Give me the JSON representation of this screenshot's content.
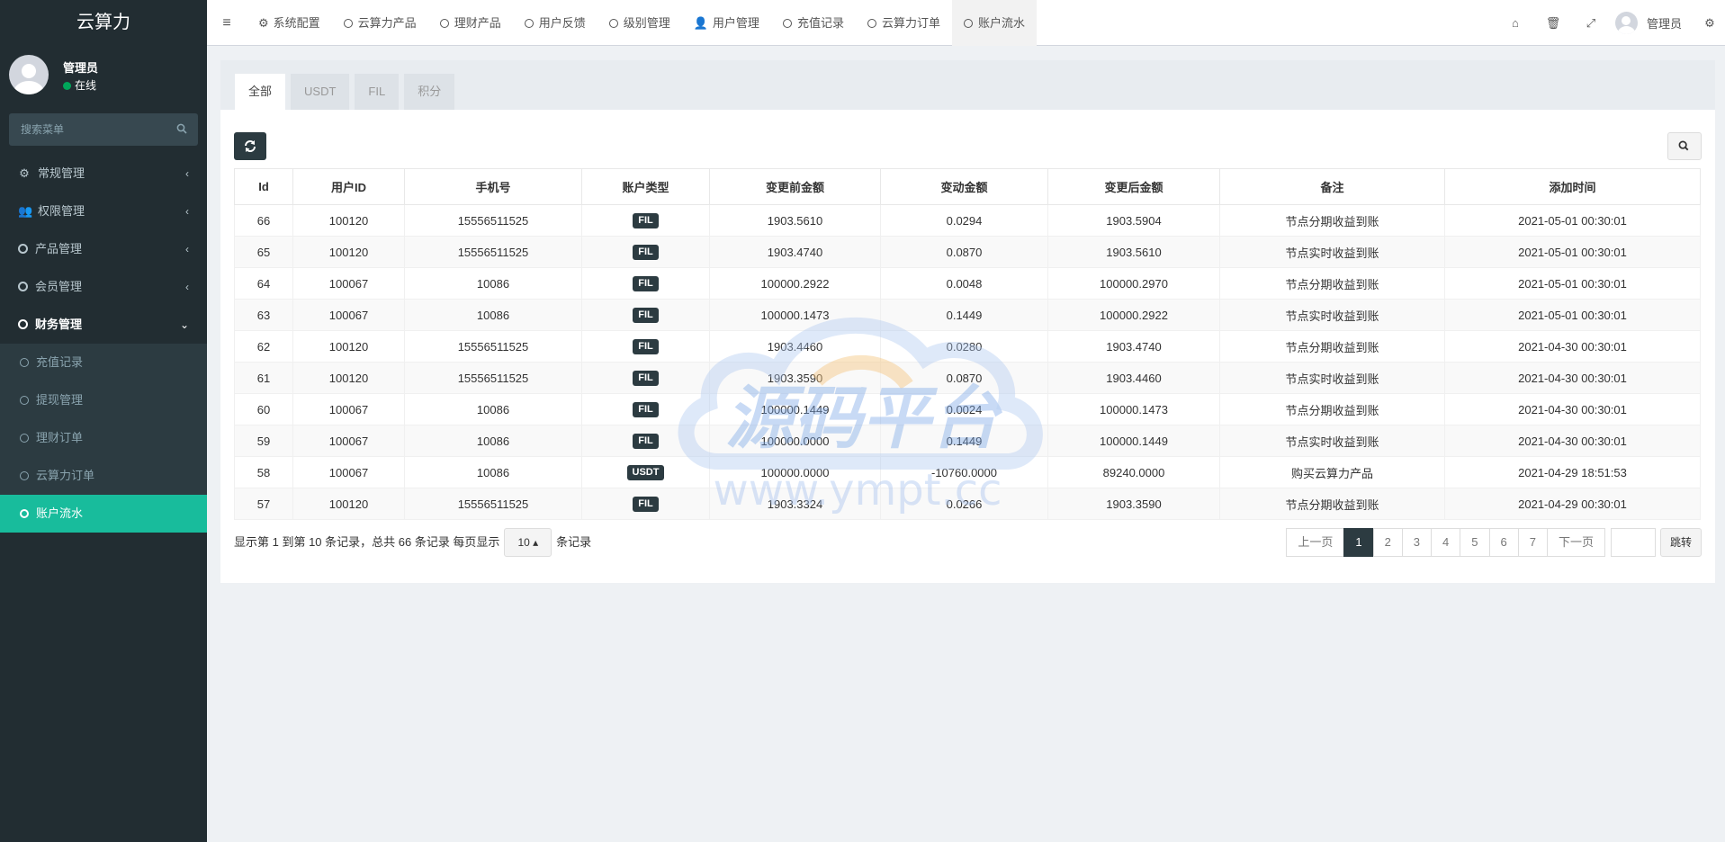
{
  "brand": "云算力",
  "user": {
    "name": "管理员",
    "status": "在线"
  },
  "search": {
    "placeholder": "搜索菜单"
  },
  "menu": [
    {
      "label": "常规管理",
      "icon": "gears-icon"
    },
    {
      "label": "权限管理",
      "icon": "users-icon"
    },
    {
      "label": "产品管理",
      "icon": "circle-icon"
    },
    {
      "label": "会员管理",
      "icon": "circle-icon"
    },
    {
      "label": "财务管理",
      "icon": "circle-icon"
    }
  ],
  "submenu": [
    "充值记录",
    "提现管理",
    "理财订单",
    "云算力订单",
    "账户流水"
  ],
  "topnav": [
    "系统配置",
    "云算力产品",
    "理财产品",
    "用户反馈",
    "级别管理",
    "用户管理",
    "充值记录",
    "云算力订单",
    "账户流水"
  ],
  "topuser": "管理员",
  "tabs": [
    "全部",
    "USDT",
    "FIL",
    "积分"
  ],
  "table": {
    "headers": [
      "Id",
      "用户ID",
      "手机号",
      "账户类型",
      "变更前金额",
      "变动金额",
      "变更后金额",
      "备注",
      "添加时间"
    ],
    "rows": [
      [
        "66",
        "100120",
        "15556511525",
        "FIL",
        "1903.5610",
        "0.0294",
        "1903.5904",
        "节点分期收益到账",
        "2021-05-01 00:30:01"
      ],
      [
        "65",
        "100120",
        "15556511525",
        "FIL",
        "1903.4740",
        "0.0870",
        "1903.5610",
        "节点实时收益到账",
        "2021-05-01 00:30:01"
      ],
      [
        "64",
        "100067",
        "10086",
        "FIL",
        "100000.2922",
        "0.0048",
        "100000.2970",
        "节点分期收益到账",
        "2021-05-01 00:30:01"
      ],
      [
        "63",
        "100067",
        "10086",
        "FIL",
        "100000.1473",
        "0.1449",
        "100000.2922",
        "节点实时收益到账",
        "2021-05-01 00:30:01"
      ],
      [
        "62",
        "100120",
        "15556511525",
        "FIL",
        "1903.4460",
        "0.0280",
        "1903.4740",
        "节点分期收益到账",
        "2021-04-30 00:30:01"
      ],
      [
        "61",
        "100120",
        "15556511525",
        "FIL",
        "1903.3590",
        "0.0870",
        "1903.4460",
        "节点实时收益到账",
        "2021-04-30 00:30:01"
      ],
      [
        "60",
        "100067",
        "10086",
        "FIL",
        "100000.1449",
        "0.0024",
        "100000.1473",
        "节点分期收益到账",
        "2021-04-30 00:30:01"
      ],
      [
        "59",
        "100067",
        "10086",
        "FIL",
        "100000.0000",
        "0.1449",
        "100000.1449",
        "节点实时收益到账",
        "2021-04-30 00:30:01"
      ],
      [
        "58",
        "100067",
        "10086",
        "USDT",
        "100000.0000",
        "-10760.0000",
        "89240.0000",
        "购买云算力产品",
        "2021-04-29 18:51:53"
      ],
      [
        "57",
        "100120",
        "15556511525",
        "FIL",
        "1903.3324",
        "0.0266",
        "1903.3590",
        "节点分期收益到账",
        "2021-04-29 00:30:01"
      ]
    ]
  },
  "footer": {
    "info": "显示第 1 到第 10 条记录，总共 66 条记录 每页显示",
    "page_size": "10",
    "records_suffix": "条记录"
  },
  "pager": {
    "prev": "上一页",
    "pages": [
      "1",
      "2",
      "3",
      "4",
      "5",
      "6",
      "7"
    ],
    "next": "下一页",
    "go": "跳转"
  },
  "watermark": {
    "text": "源码平台",
    "url": "www.ympt.cc"
  },
  "colors": {
    "sidebar": "#222d32",
    "accent": "#18bc9c",
    "dark_button": "#2c3b41"
  }
}
